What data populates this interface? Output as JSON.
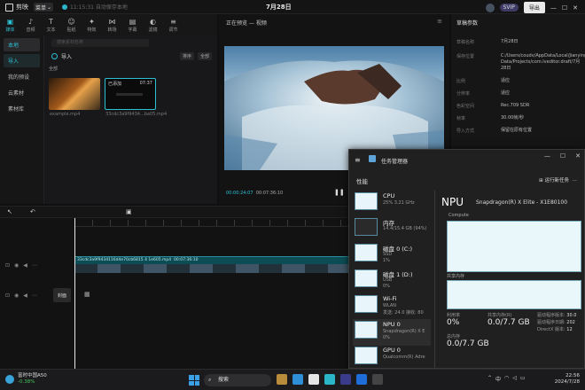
{
  "app": {
    "name": "剪映",
    "menu_label": "菜单",
    "save_status": "11:15:31 自动保存本地",
    "project_title": "7月28日",
    "svip_label": "SVIP",
    "export_label": "导出"
  },
  "toolbar": [
    {
      "label": "媒体",
      "icon": "media-icon",
      "glyph": "▣"
    },
    {
      "label": "音频",
      "icon": "audio-icon",
      "glyph": "♪"
    },
    {
      "label": "文本",
      "icon": "text-icon",
      "glyph": "T"
    },
    {
      "label": "贴纸",
      "icon": "sticker-icon",
      "glyph": "☺"
    },
    {
      "label": "特效",
      "icon": "effects-icon",
      "glyph": "✦"
    },
    {
      "label": "转场",
      "icon": "transition-icon",
      "glyph": "⋈"
    },
    {
      "label": "字幕",
      "icon": "caption-icon",
      "glyph": "▤"
    },
    {
      "label": "滤镜",
      "icon": "filter-icon",
      "glyph": "◐"
    },
    {
      "label": "调节",
      "icon": "adjust-icon",
      "glyph": "≡"
    }
  ],
  "sidenav": [
    "本地",
    "导入",
    "我的预设",
    "云素材",
    "素材库"
  ],
  "media": {
    "search_placeholder": "搜索素材名称",
    "import_label": "导入",
    "filters": [
      "排序",
      "全部"
    ],
    "all_label": "全部",
    "thumbs": [
      {
        "name": "example.mp4"
      },
      {
        "name": "33cdc3a9f9434...ba05.mp4",
        "label": "已添加",
        "duration": "07:37"
      }
    ]
  },
  "preview": {
    "title": "正在预览 — 视频",
    "current_time": "00:00:24:07",
    "total_time": "00:07:36:10"
  },
  "details": {
    "title": "草稿参数",
    "rows": [
      {
        "k": "草稿名称",
        "v": "7月28日"
      },
      {
        "k": "保存位置",
        "v": "C:/Users/coudv/AppData/Local/JianyingPro/User Data/Projects/com.lveditor.draft/7月28日"
      },
      {
        "k": "比例",
        "v": "适应"
      },
      {
        "k": "分辨率",
        "v": "适应"
      },
      {
        "k": "色彩空间",
        "v": "Rec.709 SDR"
      },
      {
        "k": "帧率",
        "v": "30.00帧/秒"
      },
      {
        "k": "导入方式",
        "v": "保留在原有位置"
      }
    ]
  },
  "timeline": {
    "clip_label": "33cdc3a9f9434116d4e70cb6815 4 1e605.mp4",
    "clip_duration": "00:07:36:10",
    "cover_label": "封面"
  },
  "taskmgr": {
    "title": "任务管理器",
    "section": "性能",
    "run_task": "运行新任务",
    "items": [
      {
        "name": "CPU",
        "s1": "25% 3.21 GHz",
        "s2": ""
      },
      {
        "name": "内存",
        "s1": "14.4/15.4 GB (94%)",
        "s2": ""
      },
      {
        "name": "磁盘 0 (C:)",
        "s1": "SSD",
        "s2": "1%"
      },
      {
        "name": "磁盘 1 (D:)",
        "s1": "USB",
        "s2": "0%"
      },
      {
        "name": "Wi-Fi",
        "s1": "WLAN",
        "s2": "发送: 24.0 接收: 80"
      },
      {
        "name": "NPU 0",
        "s1": "Snapdragon(R) X E",
        "s2": "0%"
      },
      {
        "name": "GPU 0",
        "s1": "Qualcomm(R) Adre",
        "s2": ""
      }
    ],
    "npu_title": "NPU",
    "npu_model": "Snapdragon(R) X Elite - X1E80100",
    "compute_label": "Compute",
    "shared_label": "共享内存",
    "stats": {
      "util_label": "利用率",
      "util_val": "0%",
      "shared_label": "共享内存(R)",
      "shared_val": "0.0/7.7 GB",
      "total_label": "总内存",
      "total_val": "0.0/7.7 GB",
      "drv_ver_label": "驱动程序版本:",
      "drv_ver_val": "30.0",
      "drv_date_label": "驱动程序日期:",
      "drv_date_val": "202",
      "dx_label": "DirectX 版本:",
      "dx_val": "12"
    }
  },
  "taskbar": {
    "weather_title": "富时中国A50",
    "weather_change": "-0.38%",
    "search_label": "搜索",
    "ime": "中",
    "time": "22:56",
    "date": "2024/7/28"
  }
}
